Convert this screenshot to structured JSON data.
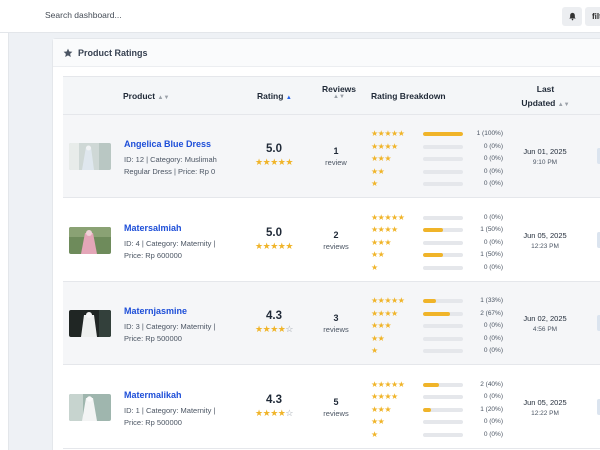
{
  "topbar": {
    "search_placeholder": "Search dashboard...",
    "filter_label": "filt"
  },
  "card": {
    "title": "Product Ratings"
  },
  "columns": {
    "product": "Product",
    "rating": "Rating",
    "reviews": "Reviews",
    "breakdown": "Rating Breakdown",
    "last_updated_1": "Last",
    "last_updated_2": "Updated"
  },
  "rows": [
    {
      "name": "Angelica Blue Dress",
      "meta": "ID: 12 | Category: Muslimah Regular Dress | Price: Rp 0",
      "rating": "5.0",
      "stars": 5,
      "reviews": "1",
      "reviews_label": "review",
      "breakdown": [
        {
          "pct": 100,
          "text": "1 (100%)"
        },
        {
          "pct": 0,
          "text": "0 (0%)"
        },
        {
          "pct": 0,
          "text": "0 (0%)"
        },
        {
          "pct": 0,
          "text": "0 (0%)"
        },
        {
          "pct": 0,
          "text": "0 (0%)"
        }
      ],
      "date": "Jun 01, 2025",
      "time": "9:10 PM"
    },
    {
      "name": "Matersalmiah",
      "meta": "ID: 4 | Category: Maternity | Price: Rp 600000",
      "rating": "5.0",
      "stars": 5,
      "reviews": "2",
      "reviews_label": "reviews",
      "breakdown": [
        {
          "pct": 0,
          "text": "0 (0%)"
        },
        {
          "pct": 50,
          "text": "1 (50%)"
        },
        {
          "pct": 0,
          "text": "0 (0%)"
        },
        {
          "pct": 50,
          "text": "1 (50%)"
        },
        {
          "pct": 0,
          "text": "0 (0%)"
        }
      ],
      "date": "Jun 05, 2025",
      "time": "12:23 PM"
    },
    {
      "name": "Maternjasmine",
      "meta": "ID: 3 | Category: Maternity | Price: Rp 500000",
      "rating": "4.3",
      "stars": 4,
      "reviews": "3",
      "reviews_label": "reviews",
      "breakdown": [
        {
          "pct": 33,
          "text": "1 (33%)"
        },
        {
          "pct": 67,
          "text": "2 (67%)"
        },
        {
          "pct": 0,
          "text": "0 (0%)"
        },
        {
          "pct": 0,
          "text": "0 (0%)"
        },
        {
          "pct": 0,
          "text": "0 (0%)"
        }
      ],
      "date": "Jun 02, 2025",
      "time": "4:56 PM"
    },
    {
      "name": "Matermalikah",
      "meta": "ID: 1 | Category: Maternity | Price: Rp 500000",
      "rating": "4.3",
      "stars": 4,
      "reviews": "5",
      "reviews_label": "reviews",
      "breakdown": [
        {
          "pct": 40,
          "text": "2 (40%)"
        },
        {
          "pct": 0,
          "text": "0 (0%)"
        },
        {
          "pct": 20,
          "text": "1 (20%)"
        },
        {
          "pct": 0,
          "text": "0 (0%)"
        },
        {
          "pct": 0,
          "text": "0 (0%)"
        }
      ],
      "date": "Jun 05, 2025",
      "time": "12:22 PM"
    }
  ],
  "colors": {
    "star": "#f0b429",
    "link": "#1d4ed8",
    "row_alt": "#f5f6f8"
  },
  "icons": {
    "bell": "bell-icon",
    "card": "star-icon",
    "sort": "sort-icon"
  }
}
